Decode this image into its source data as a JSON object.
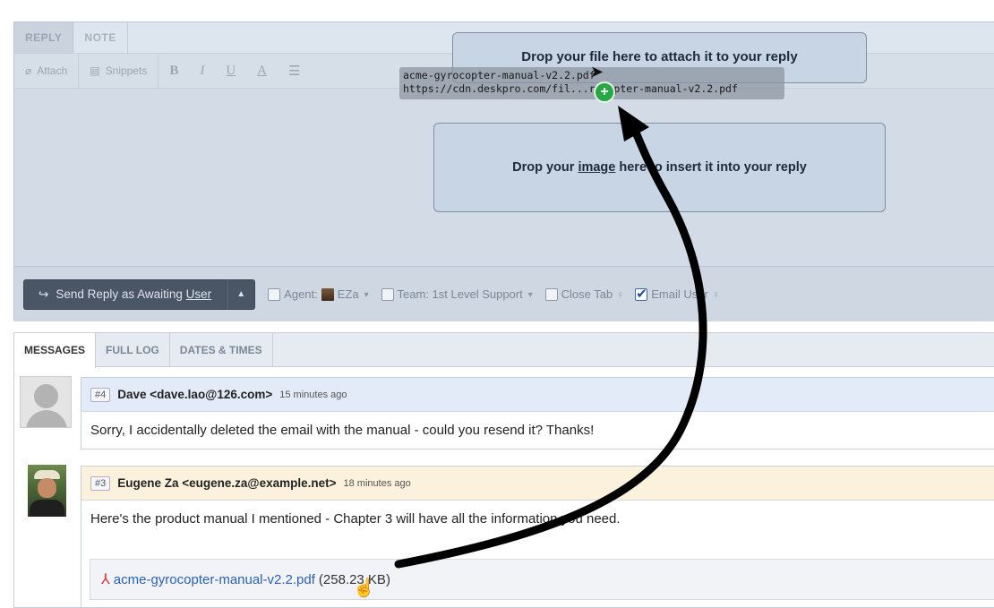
{
  "reply": {
    "tabs": [
      {
        "label": "REPLY"
      },
      {
        "label": "NOTE"
      }
    ],
    "toolbar": {
      "attach": "Attach",
      "snippets": "Snippets",
      "bold": "B",
      "italic": "I",
      "underline": "U",
      "color": "A"
    },
    "send_label_pre": "Send Reply as Awaiting ",
    "send_label_user": "User",
    "agent_label": "Agent:",
    "agent_value": "EZa",
    "team_label": "Team: 1st Level Support",
    "close_tab_label": "Close Tab",
    "email_user_label": "Email User"
  },
  "dropzones": {
    "file": "Drop your file here to attach it to your reply",
    "image_pre": "Drop your ",
    "image_word": "image",
    "image_post": " here to insert it into your reply"
  },
  "drag_ghost": {
    "filename": "acme-gyrocopter-manual-v2.2.pdf",
    "url": "https://cdn.deskpro.com/fil...rocopter-manual-v2.2.pdf"
  },
  "messages_panel": {
    "tabs": [
      {
        "label": "MESSAGES"
      },
      {
        "label": "FULL LOG"
      },
      {
        "label": "DATES & TIMES"
      }
    ],
    "messages": [
      {
        "num": "#4",
        "author": "Dave <dave.lao@126.com>",
        "time": "15 minutes ago",
        "body": "Sorry, I accidentally deleted the email with the manual - could you resend it? Thanks!"
      },
      {
        "num": "#3",
        "author": "Eugene Za <eugene.za@example.net>",
        "time": "18 minutes ago",
        "body": "Here's the product manual I mentioned - Chapter 3 will have all the information you need.",
        "attachment": {
          "name": "acme-gyrocopter-manual-v2.2.pdf",
          "size": "(258.23 KB)"
        }
      }
    ]
  },
  "colors": {
    "accent_green": "#28a845",
    "link_blue": "#2a62b4",
    "send_button": "#4a5566"
  },
  "icons": [
    "paperclip-icon",
    "snippets-icon",
    "list-icon",
    "reply-arrow-icon",
    "caret-up-icon",
    "lightbulb-icon",
    "plus-icon",
    "pdf-icon",
    "cursor-arrow-icon",
    "hand-cursor-icon"
  ]
}
